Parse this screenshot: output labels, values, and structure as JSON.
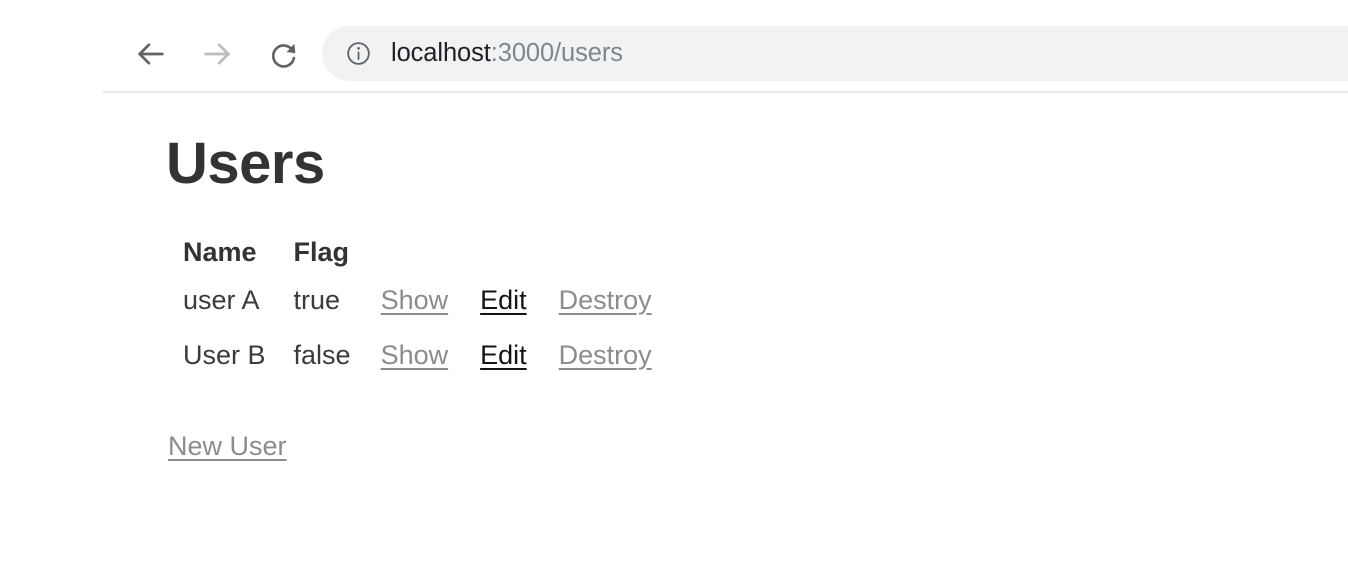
{
  "browser": {
    "back_label": "Back",
    "forward_label": "Forward",
    "reload_label": "Reload this page",
    "back_icon": "arrow-left-icon",
    "forward_icon": "arrow-right-icon",
    "reload_icon": "reload-icon",
    "site_info_icon": "info-circle-icon",
    "url_host": "localhost",
    "url_rest": ":3000/users",
    "url_full": "localhost:3000/users"
  },
  "page": {
    "title": "Users",
    "table": {
      "headers": [
        "Name",
        "Flag",
        "",
        "",
        ""
      ],
      "rows": [
        {
          "name": "user A",
          "flag": "true",
          "show": "Show",
          "edit": "Edit",
          "destroy": "Destroy"
        },
        {
          "name": "User B",
          "flag": "false",
          "show": "Show",
          "edit": "Edit",
          "destroy": "Destroy"
        }
      ]
    },
    "new_user_label": "New User"
  },
  "colors": {
    "heading": "#333333",
    "body_text": "#3b3b3b",
    "muted_link": "#8c8c8c",
    "strong_link": "#141414",
    "url_host": "#202124",
    "url_rest": "#80868b",
    "address_bar_bg": "#f1f2f4",
    "toolbar_divider": "#e9eaee",
    "page_bg": "#ffffff"
  }
}
